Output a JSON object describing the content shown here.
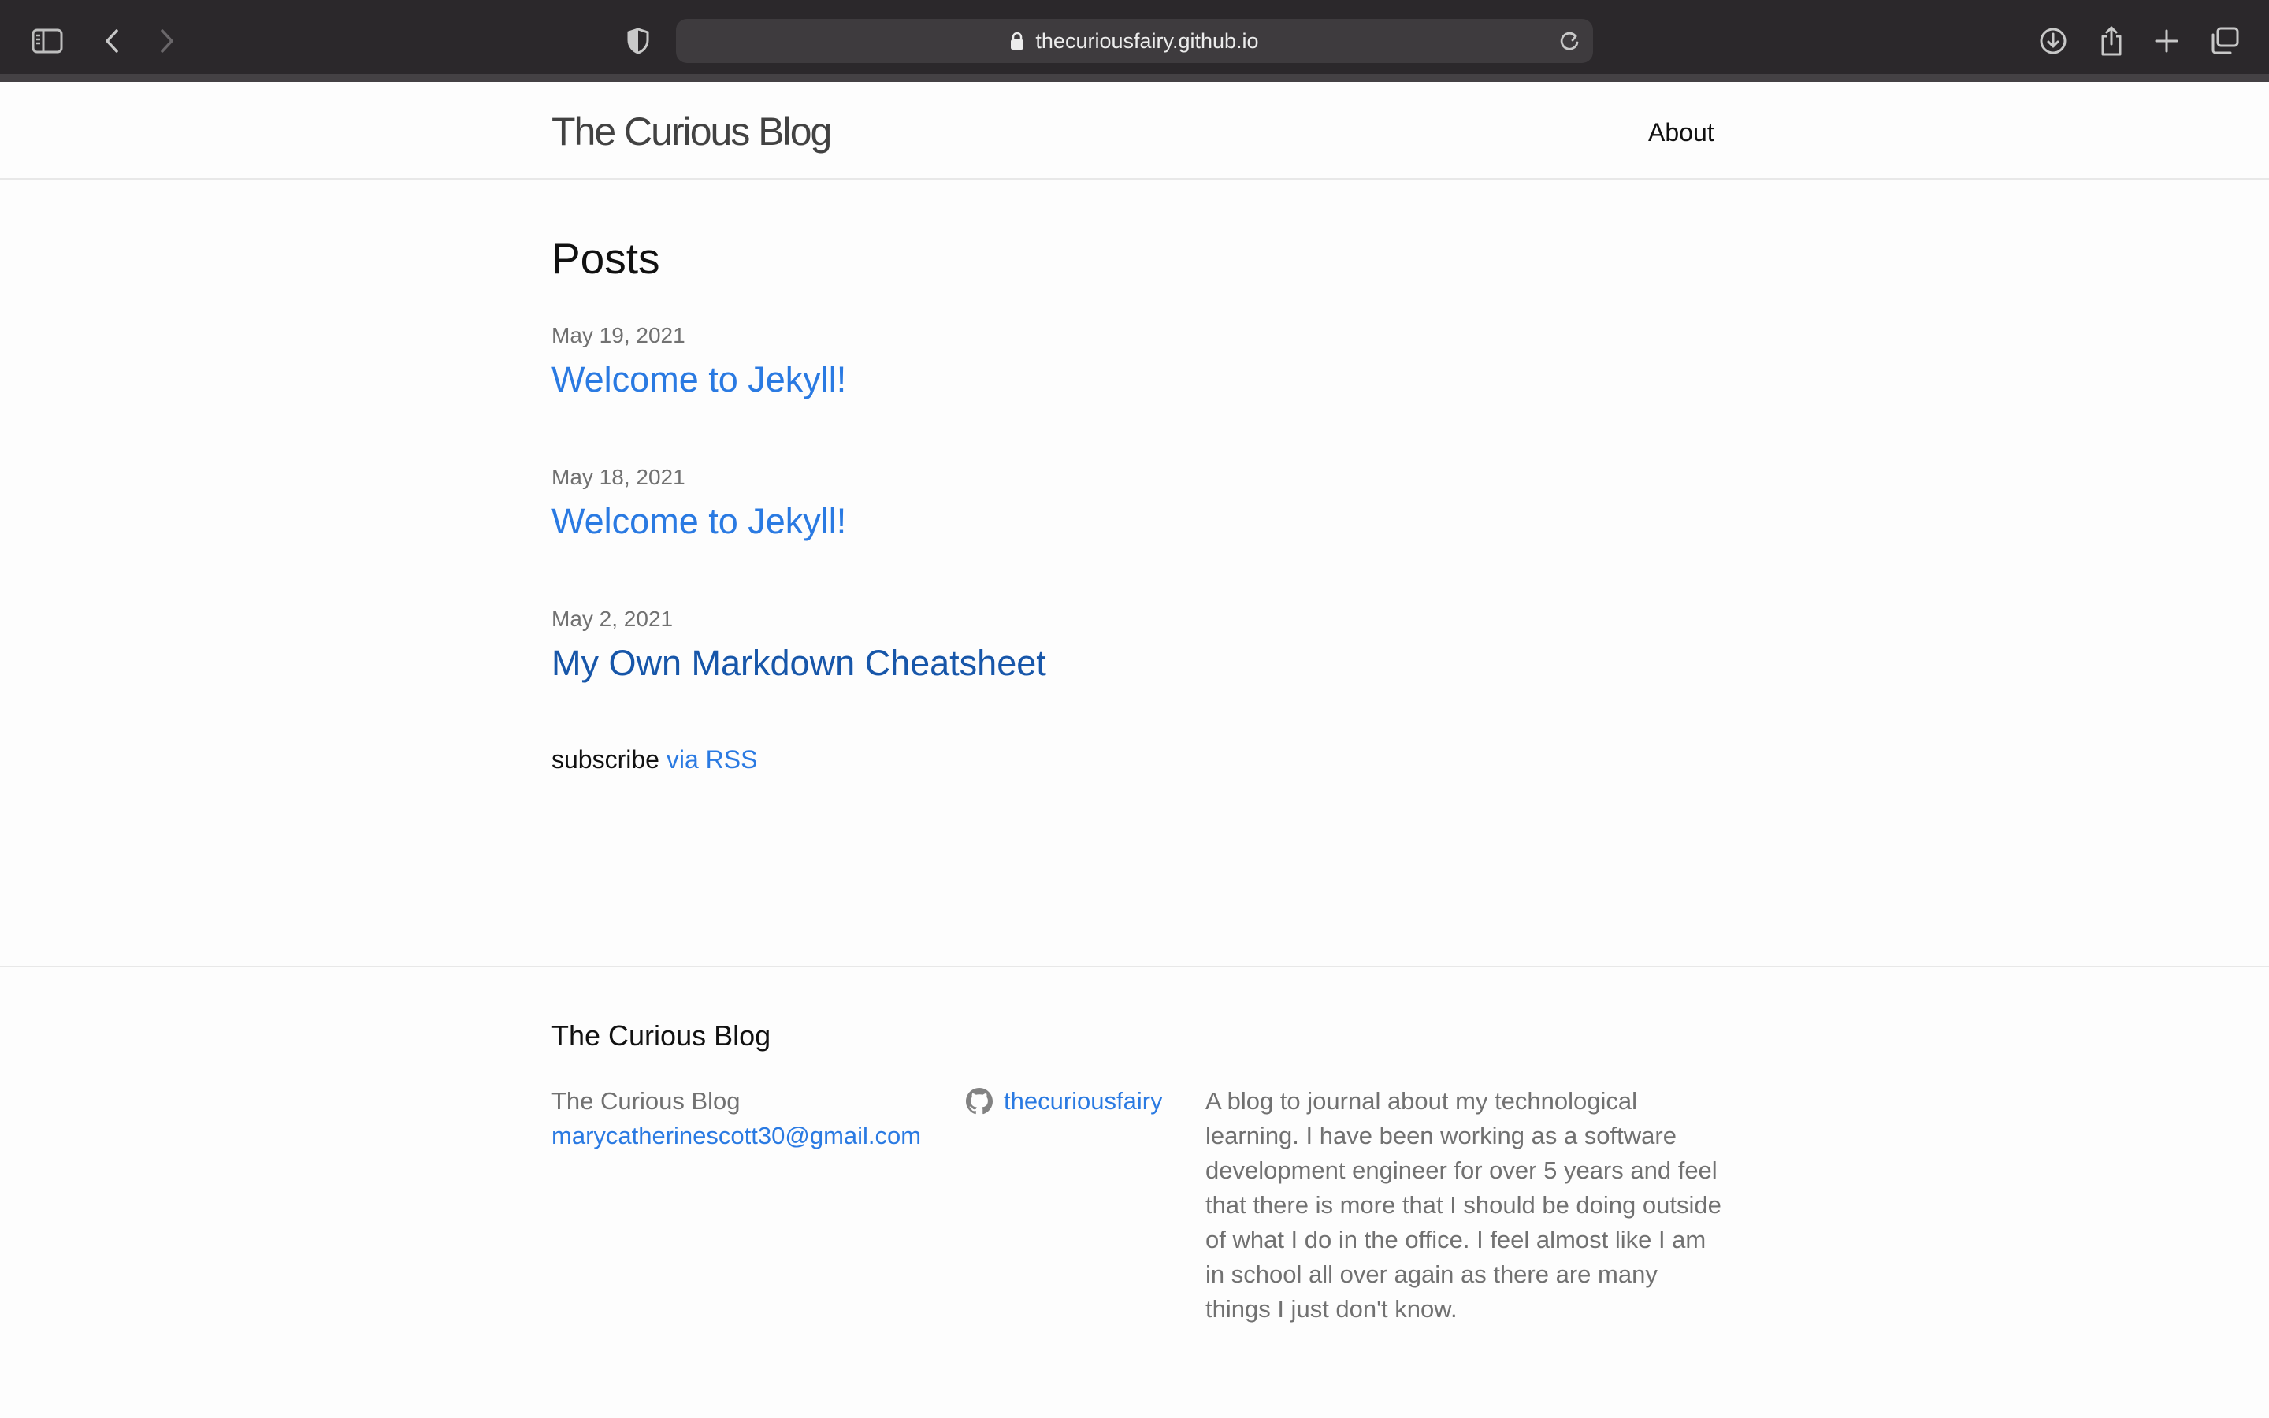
{
  "browser": {
    "url": "thecuriousfairy.github.io"
  },
  "header": {
    "site_title": "The Curious Blog",
    "nav": [
      {
        "label": "About"
      }
    ]
  },
  "main": {
    "heading": "Posts",
    "posts": [
      {
        "date": "May 19, 2021",
        "title": "Welcome to Jekyll!"
      },
      {
        "date": "May 18, 2021",
        "title": "Welcome to Jekyll!"
      },
      {
        "date": "May 2, 2021",
        "title": "My Own Markdown Cheatsheet"
      }
    ],
    "subscribe_text": "subscribe",
    "subscribe_link": "via RSS"
  },
  "footer": {
    "heading": "The Curious Blog",
    "name": "The Curious Blog",
    "email": "marycatherinescott30@gmail.com",
    "github_user": "thecuriousfairy",
    "description": "A blog to journal about my technological learning. I have been working as a software development engineer for over 5 years and feel that there is more that I should be doing outside of what I do in the office. I feel almost like I am in school all over again as there are many things I just don't know."
  },
  "colors": {
    "chrome": "#2b282b",
    "link": "#2a7ae2",
    "visited_link": "#1756a9",
    "muted_text": "#717171"
  },
  "icons": [
    "sidebar-icon",
    "back-icon",
    "forward-icon",
    "privacy-shield-icon",
    "lock-icon",
    "reload-icon",
    "download-icon",
    "share-icon",
    "new-tab-icon",
    "tab-overview-icon",
    "github-icon"
  ]
}
